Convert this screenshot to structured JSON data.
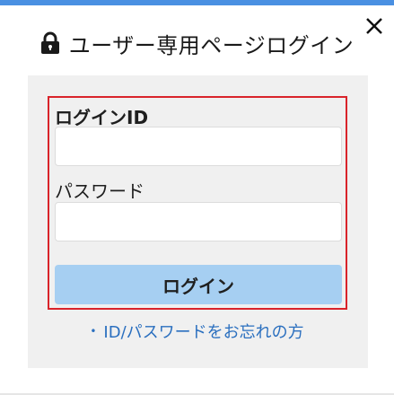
{
  "colors": {
    "top_bar": "#4a90e2",
    "accent_link": "#2a6fbf",
    "button_bg": "#a6cff2",
    "highlight_border": "#d9232a"
  },
  "header": {
    "lock_icon": "lock-icon",
    "title": "ユーザー専用ページログイン",
    "close_icon": "close-icon"
  },
  "form": {
    "login_id_label": "ログインID",
    "login_id_value": "",
    "password_label": "パスワード",
    "password_value": "",
    "submit_label": "ログイン"
  },
  "links": {
    "forgot_label": "ID/パスワードをお忘れの方",
    "forgot_icon": "bullet-icon"
  }
}
